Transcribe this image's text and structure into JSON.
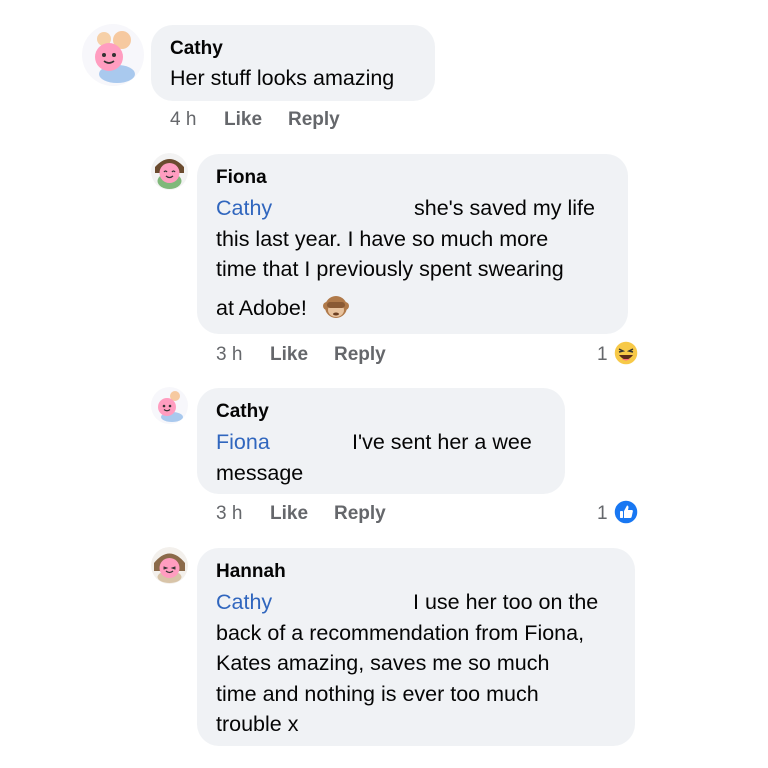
{
  "comments": [
    {
      "author": "Cathy",
      "lines": [
        "Her stuff looks amazing"
      ],
      "time": "4 h",
      "like_label": "Like",
      "reply_label": "Reply"
    },
    {
      "author": "Fiona",
      "mention": "Cathy",
      "lines": [
        "she's saved my life",
        "this last year. I have so much more",
        "time that I previously spent swearing",
        "at Adobe!"
      ],
      "time": "3 h",
      "like_label": "Like",
      "reply_label": "Reply",
      "reaction_count": "1",
      "reaction_icon": "laughing-emoji-icon"
    },
    {
      "author": "Cathy",
      "mention": "Fiona",
      "lines": [
        "I've sent her a wee",
        "message"
      ],
      "time": "3 h",
      "like_label": "Like",
      "reply_label": "Reply",
      "reaction_count": "1",
      "reaction_icon": "like-thumb-icon"
    },
    {
      "author": "Hannah",
      "mention": "Cathy",
      "lines": [
        "I use her too on the",
        "back of a recommendation from Fiona,",
        "Kates amazing, saves me so much",
        "time and nothing is ever too much",
        "trouble x"
      ]
    }
  ],
  "colors": {
    "bubble": "#f0f2f5",
    "mention": "#3066be",
    "meta": "#65676b",
    "like_blue": "#1877f2",
    "haha_yellow": "#f7c948"
  }
}
